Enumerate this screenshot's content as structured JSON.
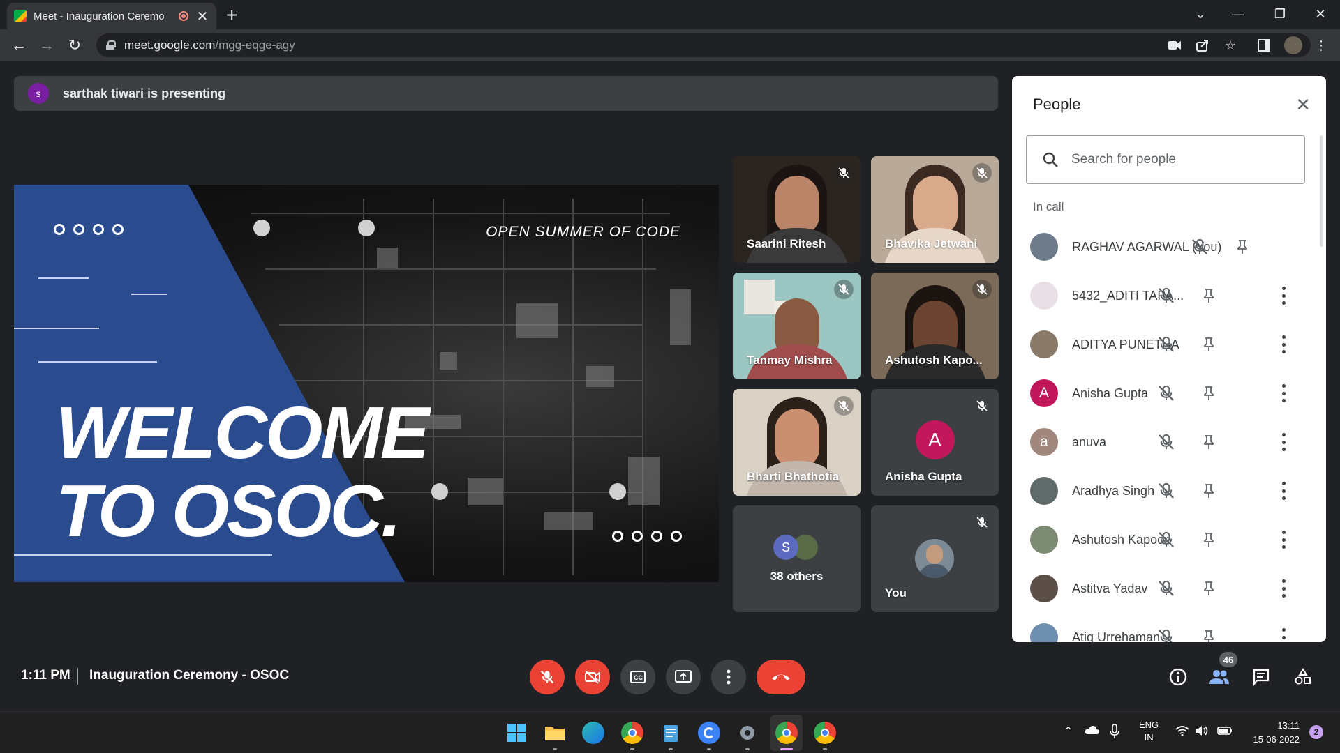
{
  "browser": {
    "tab_title": "Meet - Inauguration Ceremo",
    "url_host": "meet.google.com",
    "url_path": "/mgg-eqge-agy"
  },
  "presenting_banner": {
    "avatar_letter": "s",
    "text": "sarthak tiwari is presenting"
  },
  "slide": {
    "subtitle": "OPEN SUMMER OF CODE",
    "headline_line1": "WELCOME",
    "headline_line2": "TO OSOC."
  },
  "tiles": [
    {
      "name": "Saarini Ritesh"
    },
    {
      "name": "Bhavika Jetwani"
    },
    {
      "name": "Tanmay Mishra"
    },
    {
      "name": "Ashutosh Kapo..."
    },
    {
      "name": "Bharti Bhathotia"
    },
    {
      "name": "Anisha Gupta",
      "avatar_letter": "A"
    },
    {
      "name": "38 others",
      "avatar_letter": "S"
    },
    {
      "name": "You"
    }
  ],
  "people_panel": {
    "title": "People",
    "search_placeholder": "Search for people",
    "section_label": "In call",
    "people": [
      {
        "name": "RAGHAV AGARWAL (You)"
      },
      {
        "name": "5432_ADITI TAPA..."
      },
      {
        "name": "ADITYA PUNETHA"
      },
      {
        "name": "Anisha Gupta",
        "avatar_letter": "A"
      },
      {
        "name": "anuva",
        "avatar_letter": "a"
      },
      {
        "name": "Aradhya Singh"
      },
      {
        "name": "Ashutosh Kapoor"
      },
      {
        "name": "Astitva Yadav"
      },
      {
        "name": "Atiq Urrehaman"
      }
    ]
  },
  "meeting_bar": {
    "time": "1:11 PM",
    "meeting_title": "Inauguration Ceremony - OSOC",
    "participant_count": "46"
  },
  "taskbar": {
    "lang_line1": "ENG",
    "lang_line2": "IN",
    "clock_time": "13:11",
    "clock_date": "15-06-2022",
    "notification_count": "2"
  },
  "colors": {
    "accent_red": "#ea4335",
    "panel_bg": "#ffffff",
    "meet_bg": "#202124",
    "slide_blue": "#2a4b8d"
  }
}
